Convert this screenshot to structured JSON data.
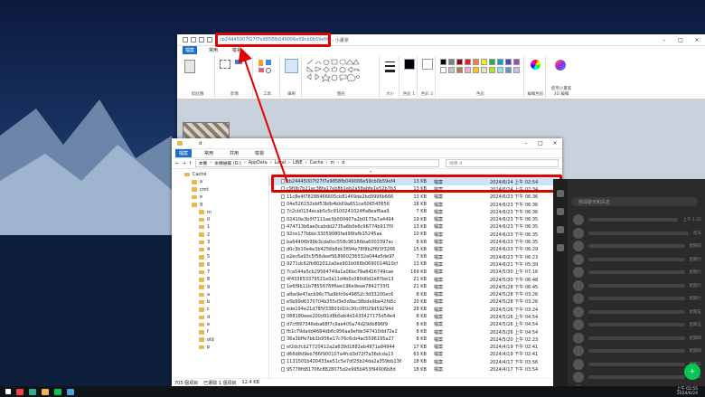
{
  "paint": {
    "title": "cb24445007f27f7e9858fb049006e59cb0b59ef4",
    "title_suffix": "- 小畫家",
    "menu": [
      "檔案",
      "常用",
      "檢視"
    ],
    "groups": {
      "clipboard": "剪貼簿",
      "image": "影像",
      "tools": "工具",
      "brush": "筆刷",
      "shapes": "圖形",
      "size": "大小",
      "color1": "色彩 1",
      "color2": "色彩 2",
      "colors": "色彩",
      "edit_colors": "編輯色彩",
      "paint3d": "使用小畫家 3D 編輯"
    },
    "colors": [
      "#000000",
      "#7f7f7f",
      "#880015",
      "#ed1c24",
      "#ff7f27",
      "#fff200",
      "#22b14c",
      "#00a2e8",
      "#3f48cc",
      "#a349a4",
      "#ffffff",
      "#c3c3c3",
      "#b97a57",
      "#ffaec9",
      "#ffc90e",
      "#efe4b0",
      "#b5e61d",
      "#99d9ea",
      "#7092be",
      "#c8bfe7"
    ]
  },
  "explorer": {
    "title": "d",
    "menu": [
      "檔案",
      "常用",
      "共用",
      "檢視"
    ],
    "path": [
      "本機",
      "本機磁碟 (G:)",
      "AppData",
      "Local",
      "LINE",
      "Cache",
      "m",
      "d"
    ],
    "search_placeholder": "搜尋 d",
    "nav": [
      "Cache",
      "a",
      "cmt",
      "e",
      "g",
      "m",
      "0",
      "1",
      "2",
      "3",
      "4",
      "5",
      "6",
      "7",
      "8",
      "9",
      "a",
      "b",
      "c",
      "d",
      "e",
      "f",
      "old",
      "p"
    ],
    "status": {
      "count": "705 個項目",
      "selected": "已選取 1 個項目",
      "size": "12.4 KB"
    },
    "files": [
      {
        "name": "cb24445007f27f7e9858fb049006e59cb0b59ef4",
        "size": "13 KB",
        "type": "檔案",
        "date": "2024/6/24 上午 02:54"
      },
      {
        "name": "c9f0b7b21ac38fa17eb8b1eb2a58abfe1e52b7b3",
        "size": "13 KB",
        "type": "檔案",
        "date": "2024/6/24 上午 02:34"
      },
      {
        "name": "11c8e4f78288466605cb81469de2bd9996b666",
        "size": "13 KB",
        "type": "檔案",
        "date": "2024/6/23 下午 06:36"
      },
      {
        "name": "04e526152ebf53bfb4bb69a651ce606545656",
        "size": "18 KB",
        "type": "檔案",
        "date": "2024/6/23 下午 06:36"
      },
      {
        "name": "7c2cb0134ecab5c5c9100241024ffa8eaf6aa9",
        "size": "7 KB",
        "type": "檔案",
        "date": "2024/6/23 下午 06:36"
      },
      {
        "name": "02410e3b0f7111ae3b000407a2b0173a7a4494",
        "size": "19 KB",
        "type": "檔案",
        "date": "2024/6/23 下午 06:35"
      },
      {
        "name": "474713b6ae0cabdd2735a6b0e6c96774b917f0",
        "size": "13 KB",
        "type": "檔案",
        "date": "2024/6/23 下午 06:35"
      },
      {
        "name": "92ce177bbbc33059080fad99fafb15245aa",
        "size": "10 KB",
        "type": "檔案",
        "date": "2024/6/23 下午 06:35"
      },
      {
        "name": "ba64406b99b3cda0cc558c96166ba6003397ac",
        "size": "8 KB",
        "type": "檔案",
        "date": "2024/6/23 下午 06:35"
      },
      {
        "name": "d0c3b10e4e3b4256b8dc3894e78f8b2f6f3f3266",
        "size": "15 KB",
        "type": "檔案",
        "date": "2024/6/23 下午 06:29"
      },
      {
        "name": "e2ec6a93c5f56deef918960236532a044a5de97",
        "size": "7 KB",
        "type": "檔案",
        "date": "2024/6/23 下午 06:23"
      },
      {
        "name": "9271dc62fb802012a0ee901b068b0690014610cf",
        "size": "13 KB",
        "type": "檔案",
        "date": "2024/6/21 下午 05:39"
      },
      {
        "name": "7ca544a5cb29564749a1a06bc79a8426749cae",
        "size": "169 KB",
        "type": "檔案",
        "date": "2024/5/30 上午 07:16"
      },
      {
        "name": "4f433653379521e0a11d4b0c080d0d2e87be13",
        "size": "21 KB",
        "type": "檔案",
        "date": "2024/5/30 下午 06:48"
      },
      {
        "name": "1e6f9b11b7855676ff6ee196e9eae7842733f1",
        "size": "21 KB",
        "type": "檔案",
        "date": "2024/5/28 下午 06:45"
      },
      {
        "name": "afbe9e47acb96c75a9bfc0e49852c3d33200ec6",
        "size": "8 KB",
        "type": "檔案",
        "date": "2024/5/28 下午 03:26"
      },
      {
        "name": "e5b99d6370704b355d3e5d9ac38bde9be42fd5c",
        "size": "20 KB",
        "type": "檔案",
        "date": "2024/5/28 下午 03:26"
      },
      {
        "name": "ede194e21d785f33803d10c30c0ff029d59294d",
        "size": "28 KB",
        "type": "檔案",
        "date": "2024/5/26 下午 03:24"
      },
      {
        "name": "088180eee200d91d8b5eb4d1433427175d54e4",
        "size": "8 KB",
        "type": "檔案",
        "date": "2024/5/26 上午 04:54"
      },
      {
        "name": "d7cf897346eba68f7c9ae405a74d29db896f9",
        "size": "8 KB",
        "type": "檔案",
        "date": "2024/5/26 上午 04:54"
      },
      {
        "name": "fb1c79dadd4684db6c956aa9efde347410dd72e2",
        "size": "8 KB",
        "type": "檔案",
        "date": "2024/5/26 上午 04:54"
      },
      {
        "name": "36a3bffe7bb1b956e17c76c6cb4ac5596195a27",
        "size": "8 KB",
        "type": "檔案",
        "date": "2024/5/20 上午 02:23"
      },
      {
        "name": "ef2dcfcb27720412a2a639d1882eb4971a84944",
        "size": "17 KB",
        "type": "檔案",
        "date": "2024/4/19 下午 02:41"
      },
      {
        "name": "d66d8d9ee766f900107a4fcd3d72f7a36dcda13",
        "size": "63 KB",
        "type": "檔案",
        "date": "2024/4/19 下午 02:41"
      },
      {
        "name": "1131501b420433ae51c5e7df25b24da2a359bb136",
        "size": "18 KB",
        "type": "檔案",
        "date": "2024/4/17 下午 03:56"
      },
      {
        "name": "95778fd81706c8828075d2e995b453f94906b8d",
        "size": "18 KB",
        "type": "檔案",
        "date": "2024/4/17 下午 03:54"
      }
    ]
  },
  "line": {
    "search_placeholder": "搜尋聊天和訊息",
    "times": [
      "上午 1:35",
      "昨天",
      "星期日",
      "星期六",
      "星期六",
      "星期六",
      "星期六",
      "星期五",
      "星期五",
      "星期四",
      "星期四",
      "星期三",
      "星期三",
      "星期二"
    ]
  },
  "taskbar": {
    "time": "上午 02:55",
    "date": "2024/6/24"
  }
}
